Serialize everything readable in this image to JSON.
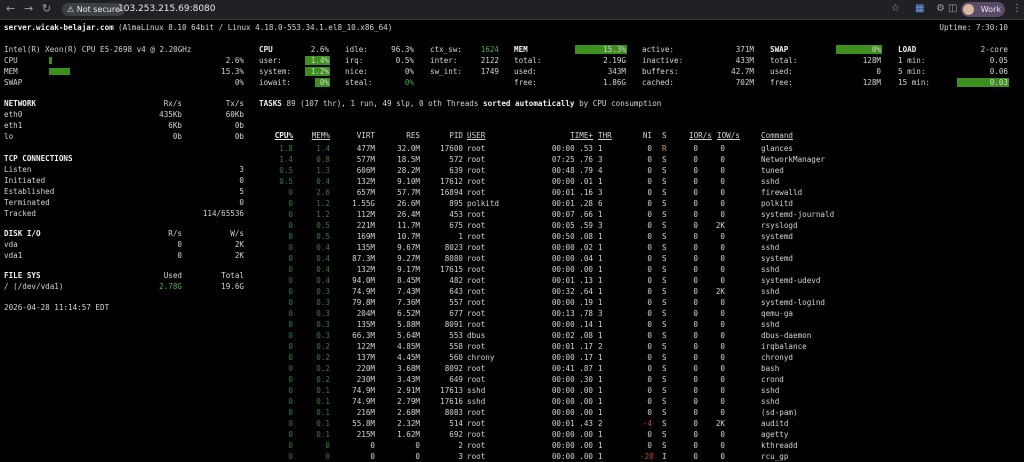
{
  "browser": {
    "security": "Not secure",
    "url": "103.253.215.69:8080",
    "profile": "Work"
  },
  "header": {
    "host": "server.wicak-belajar.com",
    "sysinfo": "(AlmaLinux 8.10 64bit / Linux 4.18.0-553.34.1.el8_10.x86_64)",
    "uptime": "Uptime: 7:30:10"
  },
  "quicklook": {
    "cpu_model": "Intel(R) Xeon(R) CPU E5-2698 v4 @ 2.20GHz",
    "rows": [
      {
        "label": "CPU",
        "value": "2.6%",
        "fraction": 0.026
      },
      {
        "label": "MEM",
        "value": "15.3%",
        "fraction": 0.153
      },
      {
        "label": "SWAP",
        "value": "0%",
        "fraction": 0
      }
    ]
  },
  "cpu": {
    "title": "CPU",
    "total": "2.6%",
    "user_label": "user:",
    "user": "1.4%",
    "system_label": "system:",
    "system": "1.2%",
    "iowait_label": "iowait:",
    "iowait": "0%",
    "idle_label": "idle:",
    "idle": "96.3%",
    "irq_label": "irq:",
    "irq": "0.5%",
    "nice_label": "nice:",
    "nice": "0%",
    "steal_label": "steal:",
    "steal": "0%",
    "ctx_sw_label": "ctx_sw:",
    "ctx_sw": "1624",
    "inter_label": "inter:",
    "inter": "2122",
    "sw_int_label": "sw_int:",
    "sw_int": "1749"
  },
  "mem": {
    "title": "MEM",
    "percent": "15.3%",
    "total_label": "total:",
    "total": "2.19G",
    "used_label": "used:",
    "used": "343M",
    "free_label": "free:",
    "free": "1.86G",
    "active_label": "active:",
    "active": "371M",
    "inactive_label": "inactive:",
    "inactive": "433M",
    "buffers_label": "buffers:",
    "buffers": "42.7M",
    "cached_label": "cached:",
    "cached": "702M"
  },
  "swap": {
    "title": "SWAP",
    "percent": "0%",
    "total_label": "total:",
    "total": "128M",
    "used_label": "used:",
    "used": "0",
    "free_label": "free:",
    "free": "128M"
  },
  "load": {
    "title": "LOAD",
    "cores": "2-core",
    "m1_label": "1 min:",
    "m1": "0.05",
    "m5_label": "5 min:",
    "m5": "0.06",
    "m15_label": "15 min:",
    "m15": "0.03"
  },
  "network": {
    "title": "NETWORK",
    "rx_label": "Rx/s",
    "tx_label": "Tx/s",
    "rows": [
      {
        "iface": "eth0",
        "rx": "435Kb",
        "tx": "60Kb"
      },
      {
        "iface": "eth1",
        "rx": "6Kb",
        "tx": "0b"
      },
      {
        "iface": "lo",
        "rx": "0b",
        "tx": "0b"
      }
    ]
  },
  "tcp": {
    "title": "TCP CONNECTIONS",
    "rows": [
      {
        "label": "Listen",
        "value": "3"
      },
      {
        "label": "Initiated",
        "value": "0"
      },
      {
        "label": "Established",
        "value": "5"
      },
      {
        "label": "Terminated",
        "value": "0"
      },
      {
        "label": "Tracked",
        "value": "114/65536"
      }
    ]
  },
  "disk": {
    "title": "DISK I/O",
    "r_label": "R/s",
    "w_label": "W/s",
    "rows": [
      {
        "name": "vda",
        "r": "0",
        "w": "2K"
      },
      {
        "name": "vda1",
        "r": "0",
        "w": "2K"
      }
    ]
  },
  "fs": {
    "title": "FILE SYS",
    "used_label": "Used",
    "total_label": "Total",
    "rows": [
      {
        "mount": "/ (/dev/vda1)",
        "used": "2.78G",
        "total": "19.6G"
      }
    ]
  },
  "datetime": "2026-04-28 11:14:57 EDT",
  "tasks": {
    "label": "TASKS",
    "summary": "89 (107 thr), 1 run, 49 slp, 0 oth Threads",
    "sorted": "sorted automatically",
    "by": "by CPU consumption"
  },
  "proc_headers": {
    "cpu": "CPU%",
    "mem": "MEM%",
    "virt": "VIRT",
    "res": "RES",
    "pid": "PID",
    "user": "USER",
    "time": "TIME+",
    "thr": "THR",
    "ni": "NI",
    "s": "S",
    "ior": "IOR/s",
    "iow": "IOW/s",
    "cmd": "Command"
  },
  "processes": [
    {
      "cpu": "1.8",
      "mem": "1.4",
      "virt": "477M",
      "res": "32.0M",
      "pid": "17600",
      "user": "root",
      "time": "00:00 .53",
      "thr": "1",
      "ni": "0",
      "s": "R",
      "ior": "0",
      "iow": "0",
      "cmd": "glances"
    },
    {
      "cpu": "1.4",
      "mem": "0.8",
      "virt": "577M",
      "res": "18.5M",
      "pid": "572",
      "user": "root",
      "time": "07:25 .76",
      "thr": "3",
      "ni": "0",
      "s": "S",
      "ior": "0",
      "iow": "0",
      "cmd": "NetworkManager"
    },
    {
      "cpu": "0.5",
      "mem": "1.3",
      "virt": "606M",
      "res": "28.2M",
      "pid": "639",
      "user": "root",
      "time": "00:48 .79",
      "thr": "4",
      "ni": "0",
      "s": "S",
      "ior": "0",
      "iow": "0",
      "cmd": "tuned"
    },
    {
      "cpu": "0.5",
      "mem": "0.4",
      "virt": "132M",
      "res": "9.10M",
      "pid": "17612",
      "user": "root",
      "time": "00:00 .01",
      "thr": "1",
      "ni": "0",
      "s": "S",
      "ior": "0",
      "iow": "0",
      "cmd": "sshd"
    },
    {
      "cpu": "0",
      "mem": "2.6",
      "virt": "657M",
      "res": "57.7M",
      "pid": "16894",
      "user": "root",
      "time": "00:01 .16",
      "thr": "3",
      "ni": "0",
      "s": "S",
      "ior": "0",
      "iow": "0",
      "cmd": "firewalld"
    },
    {
      "cpu": "0",
      "mem": "1.2",
      "virt": "1.55G",
      "res": "26.6M",
      "pid": "895",
      "user": "polkitd",
      "time": "00:01 .28",
      "thr": "6",
      "ni": "0",
      "s": "S",
      "ior": "0",
      "iow": "0",
      "cmd": "polkitd"
    },
    {
      "cpu": "0",
      "mem": "1.2",
      "virt": "112M",
      "res": "26.4M",
      "pid": "453",
      "user": "root",
      "time": "00:07 .66",
      "thr": "1",
      "ni": "0",
      "s": "S",
      "ior": "0",
      "iow": "0",
      "cmd": "systemd-journald"
    },
    {
      "cpu": "0",
      "mem": "0.5",
      "virt": "221M",
      "res": "11.7M",
      "pid": "675",
      "user": "root",
      "time": "00:05 .59",
      "thr": "3",
      "ni": "0",
      "s": "S",
      "ior": "0",
      "iow": "2K",
      "cmd": "rsyslogd"
    },
    {
      "cpu": "0",
      "mem": "0.5",
      "virt": "169M",
      "res": "10.7M",
      "pid": "1",
      "user": "root",
      "time": "00:50 .08",
      "thr": "1",
      "ni": "0",
      "s": "S",
      "ior": "0",
      "iow": "0",
      "cmd": "systemd"
    },
    {
      "cpu": "0",
      "mem": "0.4",
      "virt": "135M",
      "res": "9.67M",
      "pid": "8023",
      "user": "root",
      "time": "00:00 .02",
      "thr": "1",
      "ni": "0",
      "s": "S",
      "ior": "0",
      "iow": "0",
      "cmd": "sshd"
    },
    {
      "cpu": "0",
      "mem": "0.4",
      "virt": "87.3M",
      "res": "9.27M",
      "pid": "8080",
      "user": "root",
      "time": "00:00 .04",
      "thr": "1",
      "ni": "0",
      "s": "S",
      "ior": "0",
      "iow": "0",
      "cmd": "systemd"
    },
    {
      "cpu": "0",
      "mem": "0.4",
      "virt": "132M",
      "res": "9.17M",
      "pid": "17615",
      "user": "root",
      "time": "00:00 .00",
      "thr": "1",
      "ni": "0",
      "s": "S",
      "ior": "0",
      "iow": "0",
      "cmd": "sshd"
    },
    {
      "cpu": "0",
      "mem": "0.4",
      "virt": "94.0M",
      "res": "8.45M",
      "pid": "482",
      "user": "root",
      "time": "00:01 .13",
      "thr": "1",
      "ni": "0",
      "s": "S",
      "ior": "0",
      "iow": "0",
      "cmd": "systemd-udevd"
    },
    {
      "cpu": "0",
      "mem": "0.3",
      "virt": "74.9M",
      "res": "7.43M",
      "pid": "643",
      "user": "root",
      "time": "00:32 .64",
      "thr": "1",
      "ni": "0",
      "s": "S",
      "ior": "0",
      "iow": "2K",
      "cmd": "sshd"
    },
    {
      "cpu": "0",
      "mem": "0.3",
      "virt": "79.8M",
      "res": "7.36M",
      "pid": "557",
      "user": "root",
      "time": "00:00 .19",
      "thr": "1",
      "ni": "0",
      "s": "S",
      "ior": "0",
      "iow": "0",
      "cmd": "systemd-logind"
    },
    {
      "cpu": "0",
      "mem": "0.3",
      "virt": "204M",
      "res": "6.52M",
      "pid": "677",
      "user": "root",
      "time": "00:13 .78",
      "thr": "3",
      "ni": "0",
      "s": "S",
      "ior": "0",
      "iow": "0",
      "cmd": "qemu-ga"
    },
    {
      "cpu": "0",
      "mem": "0.3",
      "virt": "135M",
      "res": "5.88M",
      "pid": "8091",
      "user": "root",
      "time": "00:00 .14",
      "thr": "1",
      "ni": "0",
      "s": "S",
      "ior": "0",
      "iow": "0",
      "cmd": "sshd"
    },
    {
      "cpu": "0",
      "mem": "0.3",
      "virt": "66.3M",
      "res": "5.64M",
      "pid": "553",
      "user": "dbus",
      "time": "00:02 .08",
      "thr": "1",
      "ni": "0",
      "s": "S",
      "ior": "0",
      "iow": "0",
      "cmd": "dbus-daemon"
    },
    {
      "cpu": "0",
      "mem": "0.2",
      "virt": "122M",
      "res": "4.85M",
      "pid": "558",
      "user": "root",
      "time": "00:01 .17",
      "thr": "2",
      "ni": "0",
      "s": "S",
      "ior": "0",
      "iow": "0",
      "cmd": "irqbalance"
    },
    {
      "cpu": "0",
      "mem": "0.2",
      "virt": "137M",
      "res": "4.45M",
      "pid": "560",
      "user": "chrony",
      "time": "00:00 .17",
      "thr": "1",
      "ni": "0",
      "s": "S",
      "ior": "0",
      "iow": "0",
      "cmd": "chronyd"
    },
    {
      "cpu": "0",
      "mem": "0.2",
      "virt": "220M",
      "res": "3.68M",
      "pid": "8092",
      "user": "root",
      "time": "00:41 .87",
      "thr": "1",
      "ni": "0",
      "s": "S",
      "ior": "0",
      "iow": "0",
      "cmd": "bash"
    },
    {
      "cpu": "0",
      "mem": "0.2",
      "virt": "230M",
      "res": "3.43M",
      "pid": "649",
      "user": "root",
      "time": "00:00 .30",
      "thr": "1",
      "ni": "0",
      "s": "S",
      "ior": "0",
      "iow": "0",
      "cmd": "crond"
    },
    {
      "cpu": "0",
      "mem": "0.1",
      "virt": "74.9M",
      "res": "2.91M",
      "pid": "17613",
      "user": "sshd",
      "time": "00:00 .00",
      "thr": "1",
      "ni": "0",
      "s": "S",
      "ior": "0",
      "iow": "0",
      "cmd": "sshd"
    },
    {
      "cpu": "0",
      "mem": "0.1",
      "virt": "74.9M",
      "res": "2.79M",
      "pid": "17616",
      "user": "sshd",
      "time": "00:00 .00",
      "thr": "1",
      "ni": "0",
      "s": "S",
      "ior": "0",
      "iow": "0",
      "cmd": "sshd"
    },
    {
      "cpu": "0",
      "mem": "0.1",
      "virt": "216M",
      "res": "2.68M",
      "pid": "8083",
      "user": "root",
      "time": "00:00 .00",
      "thr": "1",
      "ni": "0",
      "s": "S",
      "ior": "0",
      "iow": "0",
      "cmd": "(sd-pam)"
    },
    {
      "cpu": "0",
      "mem": "0.1",
      "virt": "55.8M",
      "res": "2.32M",
      "pid": "514",
      "user": "root",
      "time": "00:01 .43",
      "thr": "2",
      "ni": "-4",
      "s": "S",
      "ior": "0",
      "iow": "2K",
      "cmd": "auditd"
    },
    {
      "cpu": "0",
      "mem": "0.1",
      "virt": "215M",
      "res": "1.62M",
      "pid": "692",
      "user": "root",
      "time": "00:00 .00",
      "thr": "1",
      "ni": "0",
      "s": "S",
      "ior": "0",
      "iow": "0",
      "cmd": "agetty"
    },
    {
      "cpu": "0",
      "mem": "0",
      "virt": "0",
      "res": "0",
      "pid": "2",
      "user": "root",
      "time": "00:00 .00",
      "thr": "1",
      "ni": "0",
      "s": "S",
      "ior": "0",
      "iow": "0",
      "cmd": "kthreadd"
    },
    {
      "cpu": "0",
      "mem": "0",
      "virt": "0",
      "res": "0",
      "pid": "3",
      "user": "root",
      "time": "00:00 .00",
      "thr": "1",
      "ni": "-20",
      "s": "I",
      "ior": "0",
      "iow": "0",
      "cmd": "rcu_gp"
    }
  ]
}
